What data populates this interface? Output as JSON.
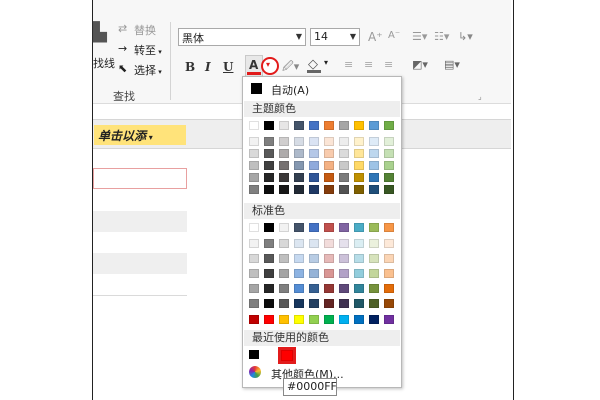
{
  "ribbon": {
    "clear_label": "替换",
    "goto_label": "转至",
    "select_label": "选择",
    "find_partial": "找线",
    "find_group_label": "查找",
    "font_name": "黑体",
    "font_size": "14",
    "bold": "B",
    "italic": "I",
    "underline": "U",
    "font_color_letter": "A"
  },
  "sheet": {
    "header_label": "单击以添"
  },
  "color_menu": {
    "auto_label": "自动(A)",
    "theme_header": "主题颜色",
    "standard_header": "标准色",
    "recent_header": "最近使用的颜色",
    "more_colors_label": "其他颜色(M)...",
    "theme_colors": [
      "#ffffff",
      "#000000",
      "#e7e6e6",
      "#44546a",
      "#4472c4",
      "#ed7d31",
      "#a5a5a5",
      "#ffc000",
      "#5b9bd5",
      "#70ad47"
    ],
    "theme_shades": [
      [
        "#f2f2f2",
        "#7f7f7f",
        "#d0cece",
        "#d6dce5",
        "#dae3f3",
        "#fbe5d6",
        "#ededed",
        "#fff2cc",
        "#deebf7",
        "#e2f0d9"
      ],
      [
        "#d9d9d9",
        "#595959",
        "#aeabab",
        "#adb9ca",
        "#b4c7e7",
        "#f8cbad",
        "#dbdbdb",
        "#ffe699",
        "#bdd7ee",
        "#c5e0b4"
      ],
      [
        "#bfbfbf",
        "#404040",
        "#767171",
        "#8497b0",
        "#8faadc",
        "#f4b183",
        "#c9c9c9",
        "#ffd966",
        "#9dc3e6",
        "#a9d18e"
      ],
      [
        "#a6a6a6",
        "#262626",
        "#3b3838",
        "#333f50",
        "#2f5597",
        "#c55a11",
        "#7b7b7b",
        "#bf9000",
        "#2e75b6",
        "#548235"
      ],
      [
        "#808080",
        "#0d0d0d",
        "#171717",
        "#222a35",
        "#1f3864",
        "#843c0c",
        "#525252",
        "#7f6000",
        "#1f4e79",
        "#385723"
      ]
    ],
    "standard_colors": [
      "#ffffff",
      "#000000",
      "#f2f2f2",
      "#44546a",
      "#4472c4",
      "#c0504d",
      "#8064a2",
      "#4bacc6",
      "#9bbb59",
      "#f79646"
    ],
    "standard_shades": [
      [
        "#f2f2f2",
        "#7f7f7f",
        "#d8d8d8",
        "#dce6f1",
        "#dbe5f1",
        "#f2dcdb",
        "#e5e0ec",
        "#dbeef3",
        "#ebf1dd",
        "#fde9d9"
      ],
      [
        "#d8d8d8",
        "#595959",
        "#bfbfbf",
        "#c6d9f0",
        "#b8cce4",
        "#e6b9b8",
        "#ccc1d9",
        "#b7dde8",
        "#d7e3bc",
        "#fbd5b5"
      ],
      [
        "#bfbfbf",
        "#3f3f3f",
        "#a5a5a5",
        "#8db3e2",
        "#95b3d7",
        "#d99694",
        "#b2a2c7",
        "#92cddc",
        "#c3d69b",
        "#fac08f"
      ],
      [
        "#a5a5a5",
        "#262626",
        "#7f7f7f",
        "#548dd4",
        "#366092",
        "#953734",
        "#5f497a",
        "#31859b",
        "#76923c",
        "#e36c09"
      ],
      [
        "#7f7f7f",
        "#0c0c0c",
        "#595959",
        "#17365d",
        "#244061",
        "#632423",
        "#3f3151",
        "#205867",
        "#4f6128",
        "#974806"
      ]
    ],
    "bright_colors": [
      "#c00000",
      "#ff0000",
      "#ffc000",
      "#ffff00",
      "#92d050",
      "#00b050",
      "#00b0f0",
      "#0070c0",
      "#002060",
      "#7030a0"
    ],
    "recent_colors": [
      "#000000",
      "#ff0000"
    ]
  },
  "tooltip": {
    "text": "#0000FF"
  },
  "colors": {
    "highlight_red": "#e21b1b",
    "label_yellow": "#ffe37a"
  }
}
